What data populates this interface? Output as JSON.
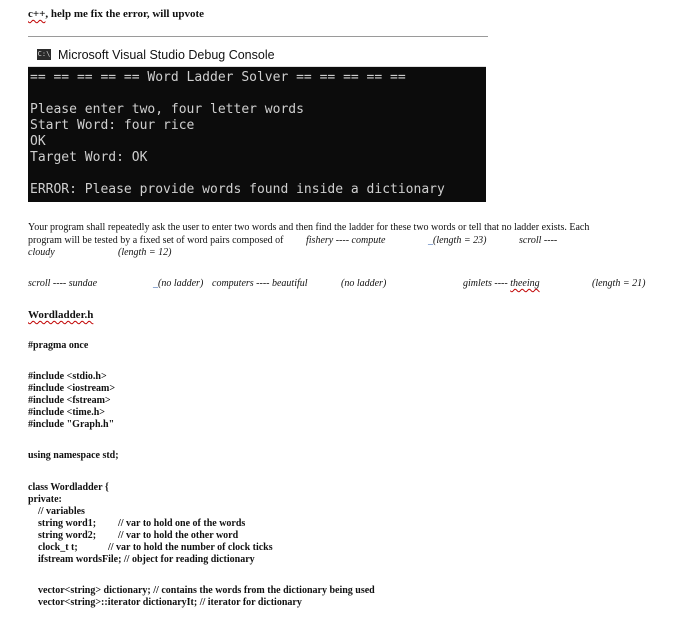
{
  "question": {
    "prefix": "c++",
    "text": ", help me fix the error, will upvote"
  },
  "console": {
    "icon_label": "C:\\",
    "title": "Microsoft Visual Studio Debug Console",
    "lines": [
      "== == == == == Word Ladder Solver == == == == ==",
      "",
      "Please enter two, four letter words",
      "Start Word: four rice",
      "OK",
      "Target Word: OK",
      "",
      "ERROR: Please provide words found inside a dictionary"
    ]
  },
  "description": {
    "line1": "Your program shall repeatedly ask the user to enter two words and then find the ladder for these two words or tell that no ladder exists. Each",
    "line2_text": "program will be tested by a fixed set of word pairs composed of",
    "pair1": "fishery ---- compute",
    "pair1_len": "(length = 23)",
    "pair2_start": "scroll ----",
    "line3_word": "cloudy",
    "line3_len": "(length = 12)"
  },
  "examples": {
    "pair3": "scroll ---- sundae",
    "pair3_result": "(no ladder)",
    "pair4": "computers ---- beautiful",
    "pair4_result": "(no ladder)",
    "pair5_a": "gimlets ---- ",
    "pair5_b": "theeing",
    "pair5_len": "(length = 21)"
  },
  "code": {
    "filename": "Wordladder.h",
    "pragma": "#pragma once",
    "includes": [
      "#include <stdio.h>",
      "#include <iostream>",
      "#include <fstream>",
      "#include <time.h>",
      "#include \"Graph.h\""
    ],
    "using": "using namespace std;",
    "class_line": "class Wordladder {",
    "private": "private:",
    "comment_vars": "// variables",
    "member1": "string word1;",
    "member1_comment": "// var to hold one of the words",
    "member2": "string word2;",
    "member2_comment": "// var to hold the other word",
    "member3": "clock_t t;",
    "member3_comment": "// var to hold the number of clock ticks",
    "member4": "ifstream wordsFile; // object for reading dictionary",
    "member5": "vector<string> dictionary; // contains the words from the dictionary being used",
    "member6": "vector<string>::iterator dictionaryIt; // iterator for dictionary"
  }
}
